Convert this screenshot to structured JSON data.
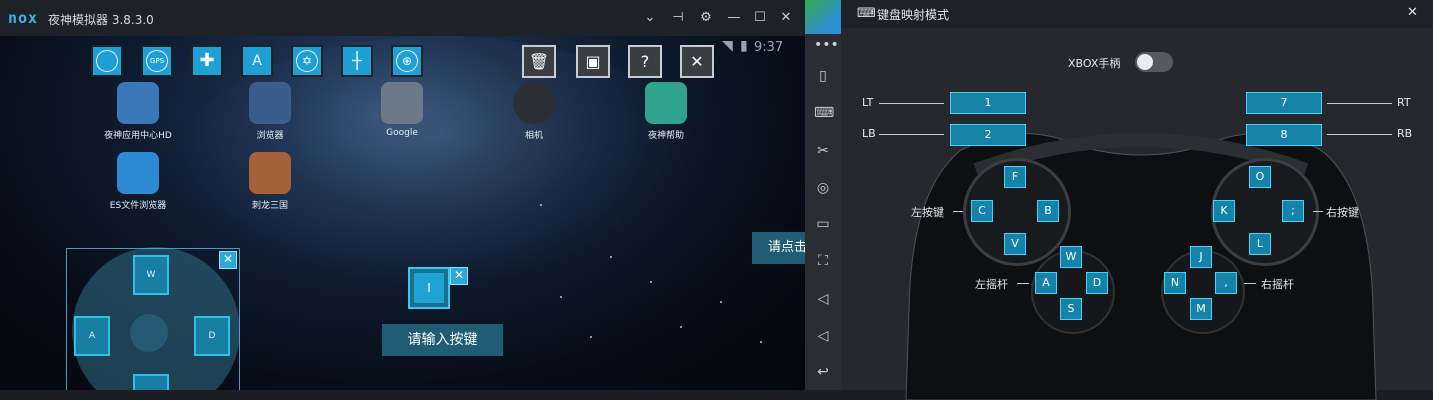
{
  "emulator": {
    "logo": "nox",
    "title": "夜神模拟器 3.8.3.0",
    "status_time": "9:37",
    "apps": [
      {
        "label": "夜神应用中心HD"
      },
      {
        "label": "浏览器"
      },
      {
        "label": "Google"
      },
      {
        "label": "相机"
      },
      {
        "label": "夜神帮助"
      },
      {
        "label": "ES文件浏览器"
      },
      {
        "label": "刺龙三国"
      }
    ],
    "toolbar": {
      "text_tool_label": "A",
      "help_label": "?",
      "close_label": "✕"
    },
    "joystick": {
      "up": "W",
      "left": "A",
      "right": "D"
    },
    "key_slot_label": "I",
    "prompt_text": "请输入按键",
    "click_hint": "请点击"
  },
  "panel": {
    "title": "键盘映射模式",
    "xbox_label": "XBOX手柄",
    "xbox_enabled": false,
    "triggers": {
      "lt": {
        "label": "LT",
        "key": "1"
      },
      "lb": {
        "label": "LB",
        "key": "2"
      },
      "rt": {
        "label": "RT",
        "key": "7"
      },
      "rb": {
        "label": "RB",
        "key": "8"
      }
    },
    "left_buttons": {
      "label": "左按键",
      "up": "F",
      "left": "C",
      "right": "B",
      "down": "V"
    },
    "right_buttons": {
      "label": "右按键",
      "up": "O",
      "left": "K",
      "right": ";",
      "down": "L"
    },
    "left_stick": {
      "label": "左摇杆",
      "up": "W",
      "left": "A",
      "right": "D",
      "down": "S"
    },
    "right_stick": {
      "label": "右摇杆",
      "up": "J",
      "left": "N",
      "right": ",",
      "down": "M"
    }
  },
  "colors": {
    "accent": "#1e9fd6",
    "key_fill": "#1583a9",
    "panel_bg": "#25282d"
  }
}
